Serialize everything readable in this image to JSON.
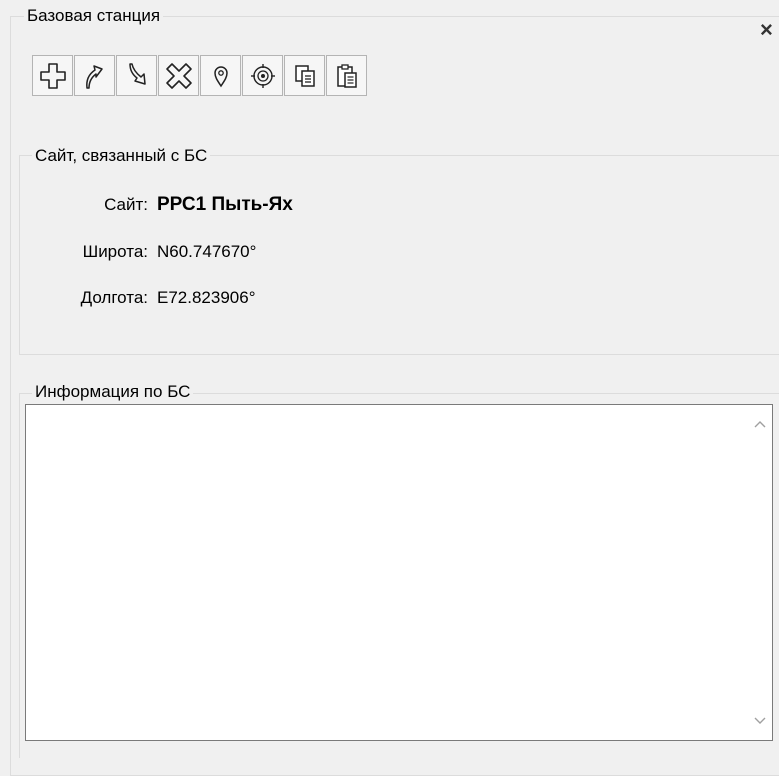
{
  "panel": {
    "title": "Базовая станция",
    "close_glyph": "×"
  },
  "toolbar": {
    "buttons": [
      {
        "name": "add-button",
        "icon": "plus-outline-icon"
      },
      {
        "name": "move-up-button",
        "icon": "curved-arrow-up-icon"
      },
      {
        "name": "move-down-button",
        "icon": "curved-arrow-down-icon"
      },
      {
        "name": "delete-button",
        "icon": "x-outline-icon"
      },
      {
        "name": "locate-button",
        "icon": "map-pin-icon"
      },
      {
        "name": "target-button",
        "icon": "target-icon"
      },
      {
        "name": "copy-button",
        "icon": "copy-icon"
      },
      {
        "name": "paste-button",
        "icon": "paste-icon"
      }
    ]
  },
  "site_group": {
    "title": "Сайт, связанный с БС",
    "site_label": "Сайт:",
    "site_value": "РРС1 Пыть-Ях",
    "lat_label": "Широта:",
    "lat_value": "N60.747670°",
    "lon_label": "Долгота:",
    "lon_value": "E72.823906°"
  },
  "info_group": {
    "title": "Информация по БС",
    "text": ""
  }
}
